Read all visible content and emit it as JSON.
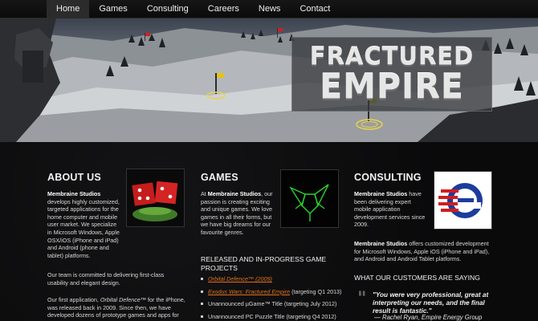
{
  "nav": {
    "items": [
      {
        "label": "Home"
      },
      {
        "label": "Games"
      },
      {
        "label": "Consulting"
      },
      {
        "label": "Careers"
      },
      {
        "label": "News"
      },
      {
        "label": "Contact"
      }
    ]
  },
  "hero": {
    "logo_line1": "FRACTURED",
    "logo_line2": "EMPIRE"
  },
  "about": {
    "title": "ABOUT US",
    "p1_lead": "Membraine Studios",
    "p1_text": "develops highly customized, targeted applications for the home computer and mobile user market. We specialize in Microsoft Windows, Apple OSX/iOS (iPhone and iPad) and Android (phone and tablet) platforms.",
    "p2": "Our team is committed to delivering first-class usability and elegant design.",
    "p3_pre": "Our first application, ",
    "p3_title": "Orbital Defence™",
    "p3_post": " for the iPhone, was released back in 2009. Since then, we have developed dozens of prototype games and apps for"
  },
  "games": {
    "title": "GAMES",
    "p1_pre": "At ",
    "p1_lead": "Membraine Studios",
    "p1_text": ", our passion is creating exciting and unique games. We love games in all their forms, but we have big dreams for our favourite genres.",
    "projects_title": "RELEASED AND IN-PROGRESS GAME PROJECTS",
    "projects": [
      {
        "link": "Orbital Defence™ (2009)",
        "rest": ""
      },
      {
        "link": "Exodus Wars: Fractured Empire",
        "rest": " (targeting Q1 2013)"
      },
      {
        "link": "",
        "rest": "Unannounced µGame™ Title (targeting July 2012)"
      },
      {
        "link": "",
        "rest": "Unannounced PC Puzzle Title (targeting Q4 2012)"
      }
    ]
  },
  "consulting": {
    "title": "CONSULTING",
    "p1_lead": "Membraine Studios",
    "p1_text": " have been delivering expert mobile application development services since 2009.",
    "p2_lead": "Membraine Studios",
    "p2_text": " offers customized development for Microsoft Windows, Apple iOS (iPhone and iPad), and Android and Android Tablet platforms.",
    "customers_title": "WHAT OUR CUSTOMERS ARE SAYING",
    "quote": "\"You were very professional, great at interpreting our needs, and the final result is fantastic.\"",
    "quote_attr": "— Rachel Ryan, Empire Energy Group"
  },
  "colors": {
    "accent_link": "#e2701a",
    "background": "#0b0b0c",
    "nav_active": "#2b2b2b"
  }
}
